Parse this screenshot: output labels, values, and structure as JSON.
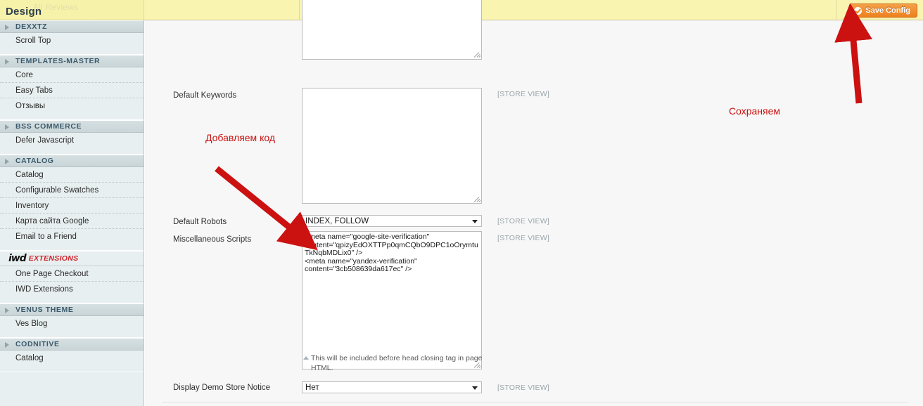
{
  "header": {
    "title": "Design",
    "ghost_tab": "All Reviews",
    "save_label": "Save Config",
    "save_icon": "check-circle-icon",
    "accent_orange": "#ee7f1f",
    "band_color": "#f9f4b0"
  },
  "sidebar": {
    "groups": [
      {
        "title": "DEXXTZ",
        "is_logo": false,
        "items": [
          "Scroll Top"
        ]
      },
      {
        "title": "TEMPLATES-MASTER",
        "is_logo": false,
        "items": [
          "Core",
          "Easy Tabs",
          "Отзывы"
        ]
      },
      {
        "title": "BSS COMMERCE",
        "is_logo": false,
        "items": [
          "Defer Javascript"
        ]
      },
      {
        "title": "CATALOG",
        "is_logo": false,
        "items": [
          "Catalog",
          "Configurable Swatches",
          "Inventory",
          "Карта сайта Google",
          "Email to a Friend"
        ]
      },
      {
        "title": "IWD EXTENSIONS",
        "is_logo": true,
        "logo_primary": "iwd",
        "logo_secondary": "EXTENSIONS",
        "items": [
          "One Page Checkout",
          "IWD Extensions"
        ]
      },
      {
        "title": "VENUS THEME",
        "is_logo": false,
        "items": [
          "Ves Blog"
        ]
      },
      {
        "title": "CODNITIVE",
        "is_logo": false,
        "items": [
          "Catalog"
        ]
      }
    ]
  },
  "main": {
    "scope_label": "[STORE VIEW]",
    "fields": [
      {
        "name": "default-description",
        "label": "",
        "type": "textarea",
        "value": "",
        "scope": ""
      },
      {
        "name": "default-keywords",
        "label": "Default Keywords",
        "type": "textarea",
        "value": "",
        "scope": "[STORE VIEW]"
      },
      {
        "name": "default-robots",
        "label": "Default Robots",
        "type": "select",
        "value": "INDEX, FOLLOW",
        "scope": "[STORE VIEW]"
      },
      {
        "name": "miscellaneous-scripts",
        "label": "Miscellaneous Scripts",
        "type": "textarea",
        "value": "<meta name=\"google-site-verification\" content=\"qpizyEdOXTTPp0qmCQbO9DPC1oOrymtuTkNqbMDLix0\" />\n<meta name=\"yandex-verification\" content=\"3cb508639da617ec\" />",
        "scope": "[STORE VIEW]",
        "hint": "This will be included before head closing tag in page HTML."
      },
      {
        "name": "display-demo-store-notice",
        "label": "Display Demo Store Notice",
        "type": "select",
        "value": "Нет",
        "scope": "[STORE VIEW]"
      }
    ]
  },
  "annotations": {
    "color": "#cc1111",
    "items": [
      {
        "name": "add-code-annotation",
        "text": "Добавляем код"
      },
      {
        "name": "save-annotation",
        "text": "Сохраняем"
      }
    ]
  }
}
